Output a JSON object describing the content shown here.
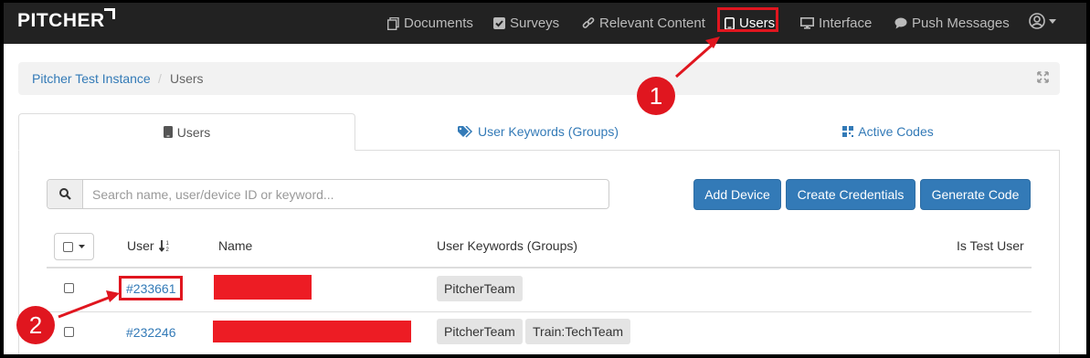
{
  "navbar": {
    "brand": "PITCHER",
    "items": [
      {
        "label": "Documents",
        "icon": "documents-icon"
      },
      {
        "label": "Surveys",
        "icon": "check-square-icon"
      },
      {
        "label": "Relevant Content",
        "icon": "link-icon"
      },
      {
        "label": "Users",
        "icon": "tablet-icon",
        "active": true
      },
      {
        "label": "Interface",
        "icon": "monitor-icon"
      },
      {
        "label": "Push Messages",
        "icon": "chat-bubble-icon"
      }
    ],
    "user_menu_icon": "user-circle-icon"
  },
  "breadcrumb": {
    "items": [
      "Pitcher Test Instance",
      "Users"
    ],
    "separator": "/"
  },
  "tabs": [
    {
      "label": "Users",
      "icon": "tablet-icon",
      "active": true
    },
    {
      "label": "User Keywords (Groups)",
      "icon": "tags-icon"
    },
    {
      "label": "Active Codes",
      "icon": "qr-grid-icon"
    }
  ],
  "search": {
    "placeholder": "Search name, user/device ID or keyword..."
  },
  "actions": {
    "add_device": "Add Device",
    "create_credentials": "Create Credentials",
    "generate_code": "Generate Code"
  },
  "table": {
    "columns": [
      "User",
      "Name",
      "User Keywords (Groups)",
      "Is Test User"
    ],
    "rows": [
      {
        "user": "#233661",
        "name_redacted": true,
        "keywords": [
          "PitcherTeam"
        ]
      },
      {
        "user": "#232246",
        "name_redacted": true,
        "keywords": [
          "PitcherTeam",
          "Train:TechTeam"
        ]
      }
    ]
  },
  "annotations": {
    "marker_1": "1",
    "marker_2": "2",
    "highlight_color": "#e0161f"
  },
  "colors": {
    "navbar_bg": "#222222",
    "link": "#337ab7",
    "button": "#337ab7",
    "redaction": "#ed1c24"
  }
}
